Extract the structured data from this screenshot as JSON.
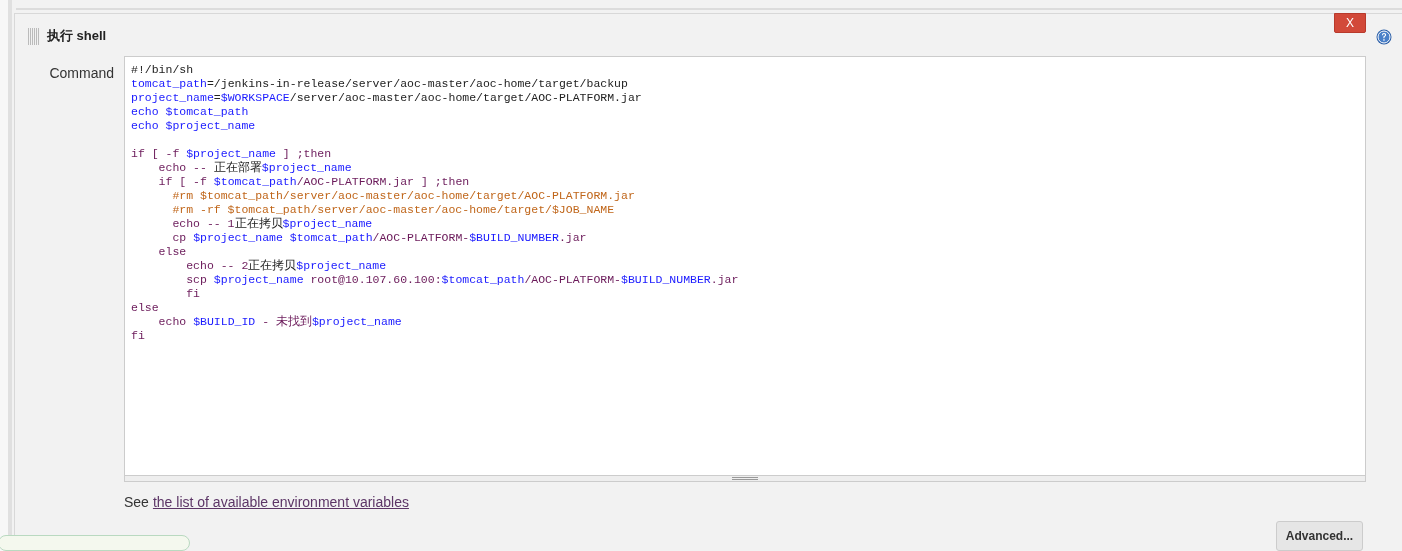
{
  "section": {
    "title": "执行 shell",
    "delete_button": "X"
  },
  "command": {
    "label": "Command",
    "lines": [
      {
        "segments": [
          {
            "kind": "plain",
            "text": "#!/bin/sh"
          }
        ]
      },
      {
        "segments": [
          {
            "kind": "var",
            "text": "tomcat_path"
          },
          {
            "kind": "plain",
            "text": "=/jenkins-in-release/server/aoc-master/aoc-home/target/backup"
          }
        ]
      },
      {
        "segments": [
          {
            "kind": "var",
            "text": "project_name"
          },
          {
            "kind": "plain",
            "text": "="
          },
          {
            "kind": "var",
            "text": "$WORKSPACE"
          },
          {
            "kind": "plain",
            "text": "/server/aoc-master/aoc-home/target/AOC-PLATFORM.jar"
          }
        ]
      },
      {
        "segments": [
          {
            "kind": "var",
            "text": "echo $tomcat_path"
          }
        ]
      },
      {
        "segments": [
          {
            "kind": "var",
            "text": "echo $project_name"
          }
        ]
      },
      {
        "blank_before": true,
        "segments": [
          {
            "kind": "keyword",
            "text": "if [ -f "
          },
          {
            "kind": "var",
            "text": "$project_name"
          },
          {
            "kind": "keyword",
            "text": " ] ;then"
          }
        ]
      },
      {
        "segments": [
          {
            "kind": "keyword",
            "text": "    echo -- "
          },
          {
            "kind": "plain",
            "text": "正在部署"
          },
          {
            "kind": "var",
            "text": "$project_name"
          }
        ]
      },
      {
        "segments": [
          {
            "kind": "keyword",
            "text": "    if [ -f "
          },
          {
            "kind": "var",
            "text": "$tomcat_path"
          },
          {
            "kind": "keyword",
            "text": "/AOC-PLATFORM.jar ] ;then"
          }
        ]
      },
      {
        "segments": [
          {
            "kind": "comment",
            "text": "      #rm $tomcat_path/server/aoc-master/aoc-home/target/AOC-PLATFORM.jar"
          }
        ]
      },
      {
        "segments": [
          {
            "kind": "comment",
            "text": "      #rm -rf $tomcat_path/server/aoc-master/aoc-home/target/$JOB_NAME"
          }
        ]
      },
      {
        "segments": [
          {
            "kind": "keyword",
            "text": "      echo -- 1"
          },
          {
            "kind": "plain",
            "text": "正在拷贝"
          },
          {
            "kind": "var",
            "text": "$project_name"
          }
        ]
      },
      {
        "segments": [
          {
            "kind": "keyword",
            "text": "      cp "
          },
          {
            "kind": "var",
            "text": "$project_name $tomcat_path"
          },
          {
            "kind": "keyword",
            "text": "/AOC-PLATFORM-"
          },
          {
            "kind": "var",
            "text": "$BUILD_NUMBER"
          },
          {
            "kind": "keyword",
            "text": ".jar"
          }
        ]
      },
      {
        "segments": [
          {
            "kind": "keyword",
            "text": "    else"
          }
        ]
      },
      {
        "segments": [
          {
            "kind": "keyword",
            "text": "        echo -- 2"
          },
          {
            "kind": "plain",
            "text": "正在拷贝"
          },
          {
            "kind": "var",
            "text": "$project_name"
          }
        ]
      },
      {
        "segments": [
          {
            "kind": "keyword",
            "text": "        scp "
          },
          {
            "kind": "var",
            "text": "$project_name"
          },
          {
            "kind": "keyword",
            "text": " root@10.107.60.100:"
          },
          {
            "kind": "var",
            "text": "$tomcat_path"
          },
          {
            "kind": "keyword",
            "text": "/AOC-PLATFORM-"
          },
          {
            "kind": "var",
            "text": "$BUILD_NUMBER"
          },
          {
            "kind": "keyword",
            "text": ".jar"
          }
        ]
      },
      {
        "segments": [
          {
            "kind": "keyword",
            "text": "        fi"
          }
        ]
      },
      {
        "segments": [
          {
            "kind": "keyword",
            "text": "else"
          }
        ]
      },
      {
        "segments": [
          {
            "kind": "keyword",
            "text": "    echo "
          },
          {
            "kind": "var",
            "text": "$BUILD_ID"
          },
          {
            "kind": "keyword",
            "text": " - 未找到"
          },
          {
            "kind": "var",
            "text": "$project_name"
          }
        ]
      },
      {
        "segments": [
          {
            "kind": "keyword",
            "text": "fi"
          }
        ]
      }
    ]
  },
  "help": {
    "prefix": "See",
    "link": "the list of available environment variables"
  },
  "advanced_button": "Advanced..."
}
